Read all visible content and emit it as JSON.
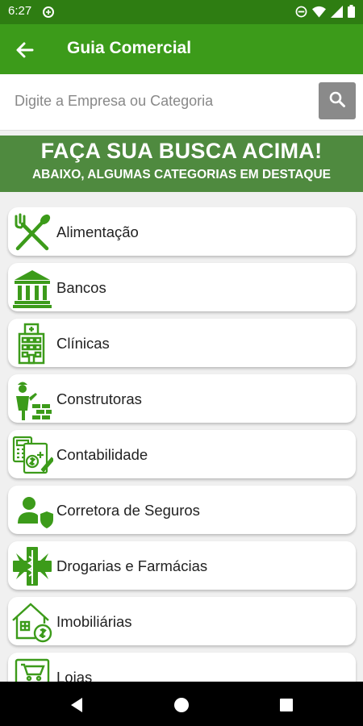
{
  "status_bar": {
    "time": "6:27"
  },
  "app_bar": {
    "title": "Guia Comercial"
  },
  "search": {
    "placeholder": "Digite a Empresa ou Categoria"
  },
  "banner": {
    "title": "FAÇA SUA BUSCA ACIMA!",
    "subtitle": "ABAIXO, ALGUMAS CATEGORIAS EM DESTAQUE"
  },
  "categories": [
    {
      "label": "Alimentação",
      "icon": "fork-spoon-icon"
    },
    {
      "label": "Bancos",
      "icon": "bank-icon"
    },
    {
      "label": "Clínicas",
      "icon": "hospital-building-icon"
    },
    {
      "label": "Construtoras",
      "icon": "builder-bricks-icon"
    },
    {
      "label": "Contabilidade",
      "icon": "calculator-document-icon"
    },
    {
      "label": "Corretora de Seguros",
      "icon": "person-shield-icon"
    },
    {
      "label": "Drogarias e Farmácias",
      "icon": "caduceus-icon"
    },
    {
      "label": "Imobiliárias",
      "icon": "house-money-icon"
    },
    {
      "label": "Lojas",
      "icon": "store-cart-icon"
    }
  ],
  "colors": {
    "status_bar": "#2e7d12",
    "app_bar": "#3c9b1a",
    "banner": "#4f8a3f",
    "icon_green": "#3c9b1a",
    "search_button": "#8a8a8a"
  }
}
